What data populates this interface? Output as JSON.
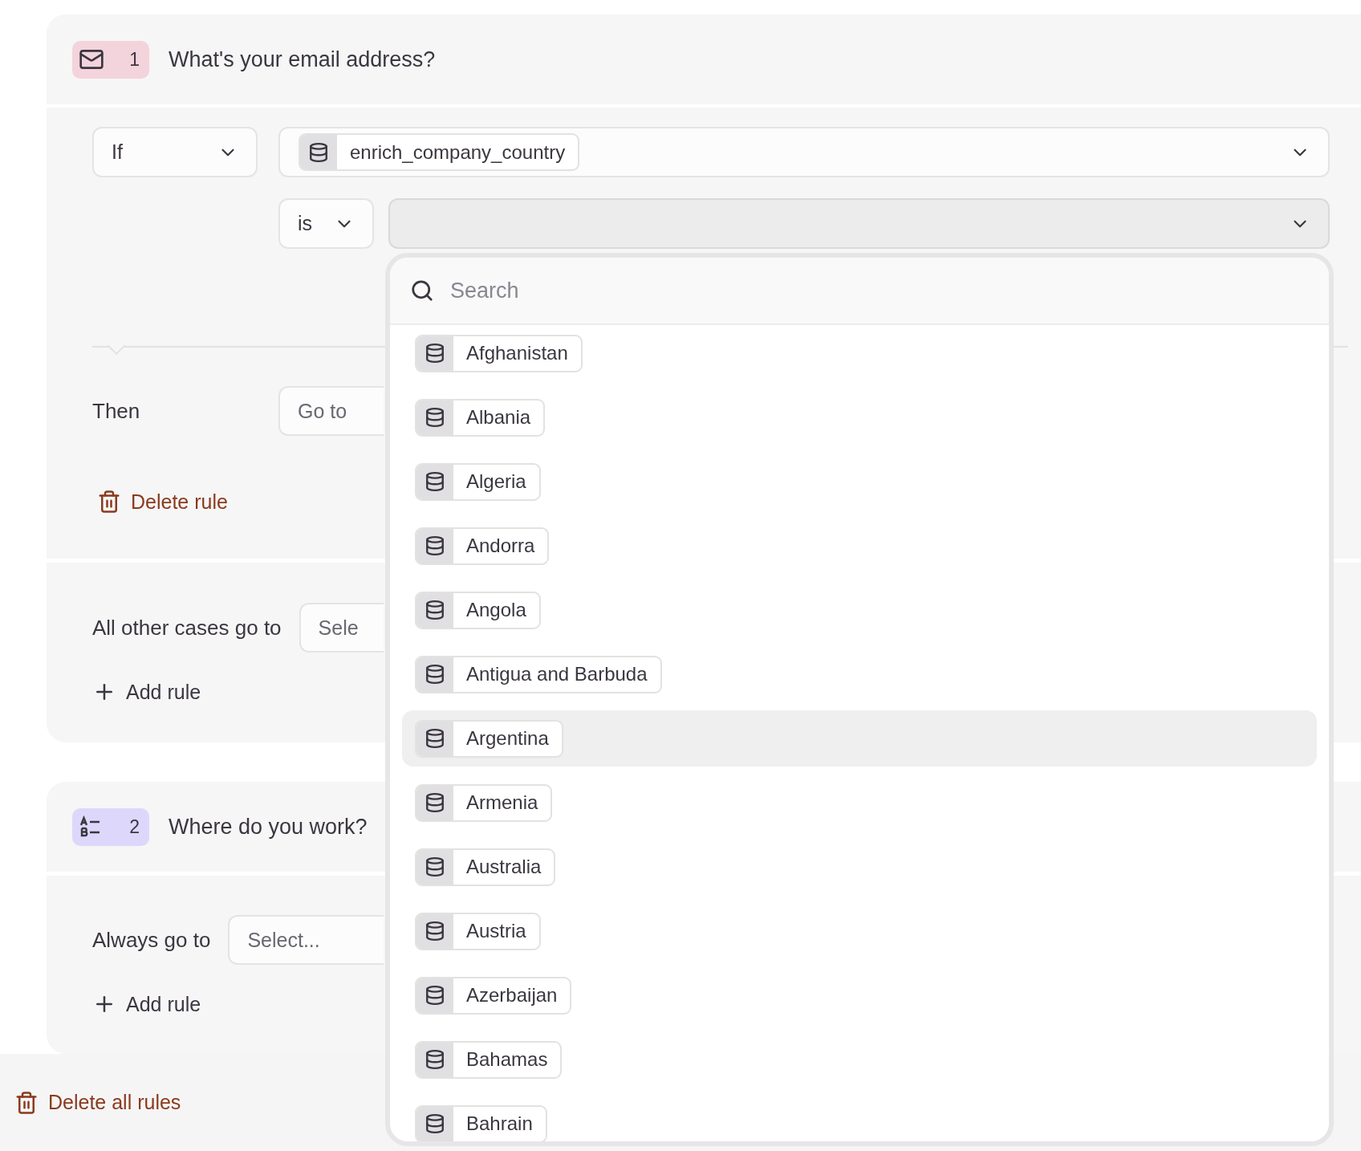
{
  "blocks": [
    {
      "kind": "email",
      "number": "1",
      "title": "What's your email address?",
      "rule": {
        "condition": "If",
        "field": "enrich_company_country",
        "operator": "is",
        "then_label": "Then",
        "action": "Go to",
        "delete": "Delete rule"
      },
      "fallback": {
        "label": "All other cases go to",
        "value": "Sele"
      },
      "add_rule": "Add rule"
    },
    {
      "kind": "choice",
      "number": "2",
      "title": "Where do you work?",
      "fallback": {
        "label": "Always go to",
        "value": "Select..."
      },
      "add_rule": "Add rule"
    }
  ],
  "dropdown": {
    "search": {
      "placeholder": "Search"
    },
    "options": [
      {
        "label": "Afghanistan",
        "highlighted": false
      },
      {
        "label": "Albania",
        "highlighted": false
      },
      {
        "label": "Algeria",
        "highlighted": false
      },
      {
        "label": "Andorra",
        "highlighted": false
      },
      {
        "label": "Angola",
        "highlighted": false
      },
      {
        "label": "Antigua and Barbuda",
        "highlighted": false
      },
      {
        "label": "Argentina",
        "highlighted": true
      },
      {
        "label": "Armenia",
        "highlighted": false
      },
      {
        "label": "Australia",
        "highlighted": false
      },
      {
        "label": "Austria",
        "highlighted": false
      },
      {
        "label": "Azerbaijan",
        "highlighted": false
      },
      {
        "label": "Bahamas",
        "highlighted": false
      },
      {
        "label": "Bahrain",
        "highlighted": false
      }
    ]
  },
  "delete_all": "Delete all rules"
}
